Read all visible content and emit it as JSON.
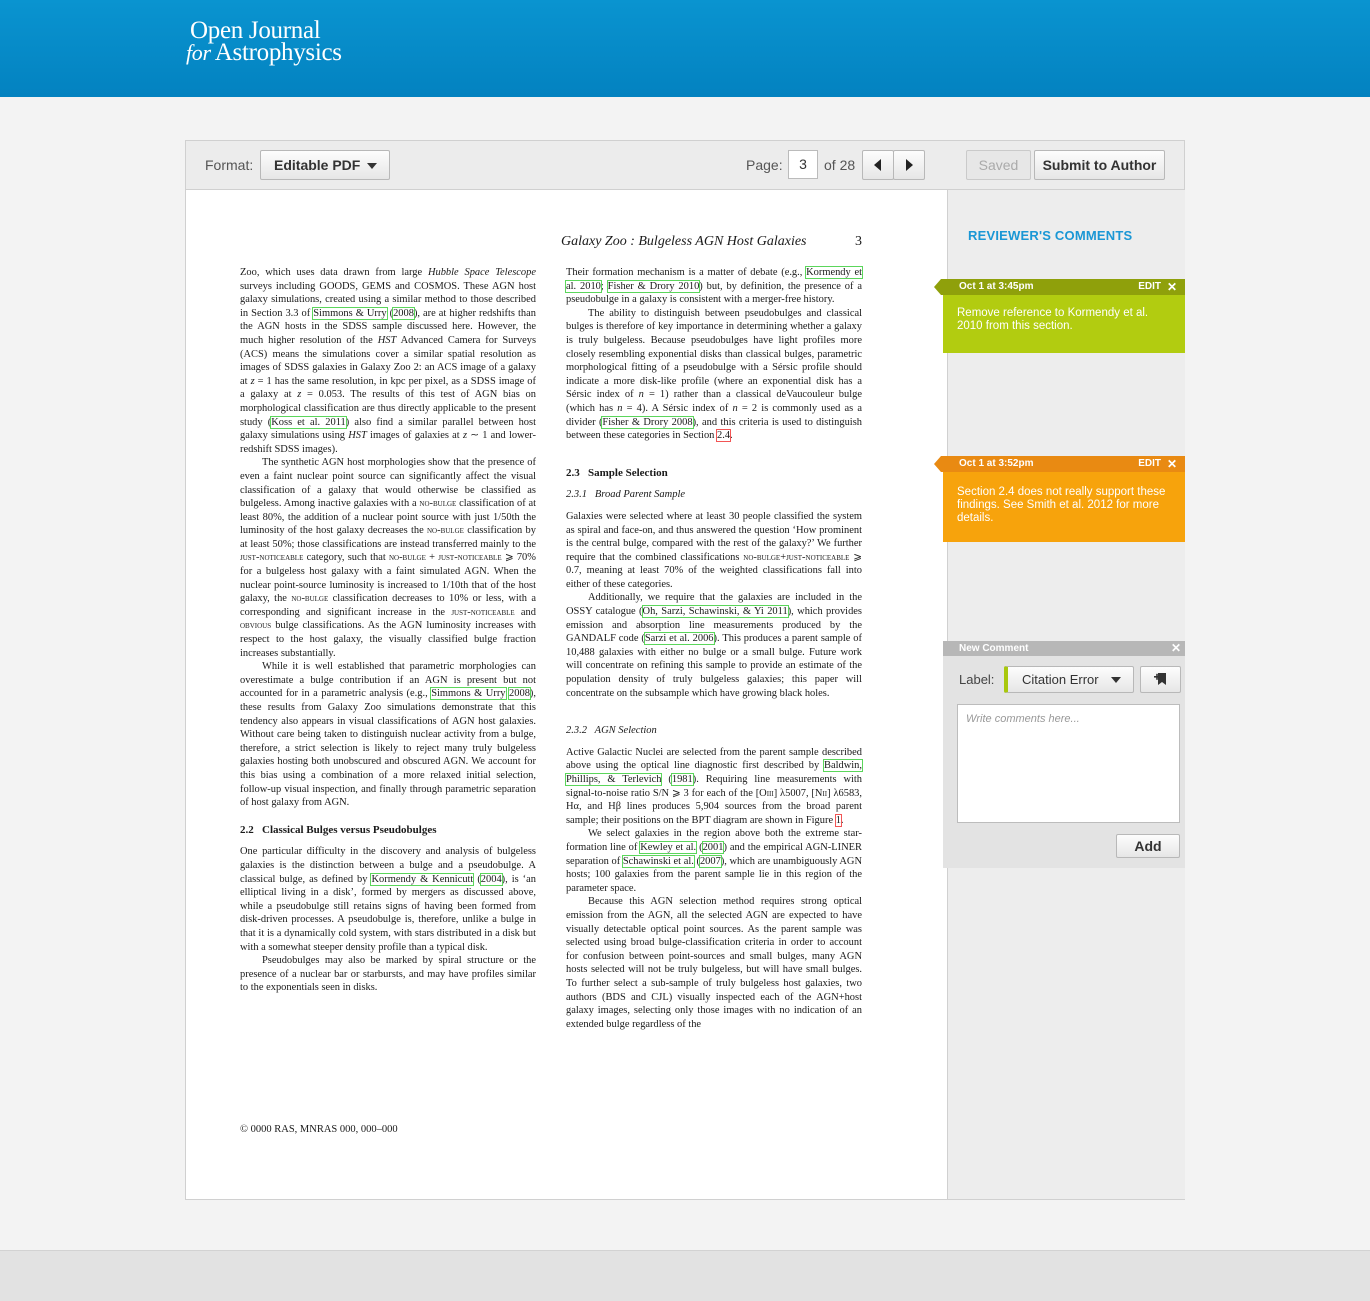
{
  "header": {
    "logo_line1": "Open Journal",
    "logo_for": "for",
    "logo_line2": "Astrophysics"
  },
  "toolbar": {
    "format_label": "Format:",
    "format_value": "Editable PDF",
    "page_label": "Page:",
    "page_current": "3",
    "page_total": "of 28",
    "saved_label": "Saved",
    "submit_label": "Submit to Author"
  },
  "document": {
    "running_head": "Galaxy Zoo : Bulgeless AGN Host Galaxies",
    "page_number": "3",
    "copyright": "© 0000 RAS, MNRAS 000, 000–000"
  },
  "sidebar": {
    "title": "REVIEWER'S COMMENTS",
    "comments": [
      {
        "time": "Oct 1 at 3:45pm",
        "edit": "EDIT",
        "close": "✕",
        "text": "Remove reference to Kormendy et al. 2010 from this section.",
        "color": "#b2cc10",
        "header_color": "#8fa00b"
      },
      {
        "time": "Oct 1 at 3:52pm",
        "edit": "EDIT",
        "close": "✕",
        "text": "Section 2.4 does not really support these findings. See Smith et al. 2012 for more details.",
        "color": "#f7a30c",
        "header_color": "#e98a12"
      }
    ],
    "new_comment": {
      "title": "New Comment",
      "close": "✕",
      "label_text": "Label:",
      "label_value": "Citation Error",
      "placeholder": "Write comments here...",
      "add_label": "Add"
    }
  }
}
